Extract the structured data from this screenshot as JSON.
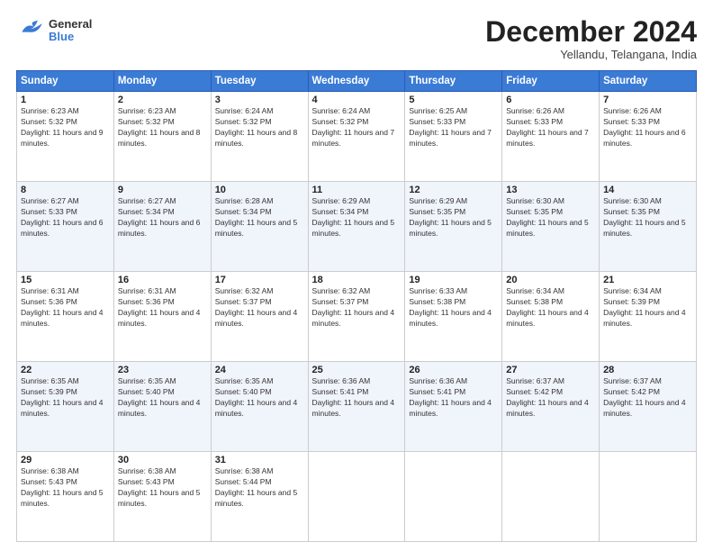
{
  "header": {
    "logo": {
      "general": "General",
      "blue": "Blue"
    },
    "month": "December 2024",
    "location": "Yellandu, Telangana, India"
  },
  "weekdays": [
    "Sunday",
    "Monday",
    "Tuesday",
    "Wednesday",
    "Thursday",
    "Friday",
    "Saturday"
  ],
  "weeks": [
    [
      {
        "day": "1",
        "sunrise": "6:23 AM",
        "sunset": "5:32 PM",
        "daylight": "11 hours and 9 minutes"
      },
      {
        "day": "2",
        "sunrise": "6:23 AM",
        "sunset": "5:32 PM",
        "daylight": "11 hours and 8 minutes"
      },
      {
        "day": "3",
        "sunrise": "6:24 AM",
        "sunset": "5:32 PM",
        "daylight": "11 hours and 8 minutes"
      },
      {
        "day": "4",
        "sunrise": "6:24 AM",
        "sunset": "5:32 PM",
        "daylight": "11 hours and 7 minutes"
      },
      {
        "day": "5",
        "sunrise": "6:25 AM",
        "sunset": "5:33 PM",
        "daylight": "11 hours and 7 minutes"
      },
      {
        "day": "6",
        "sunrise": "6:26 AM",
        "sunset": "5:33 PM",
        "daylight": "11 hours and 7 minutes"
      },
      {
        "day": "7",
        "sunrise": "6:26 AM",
        "sunset": "5:33 PM",
        "daylight": "11 hours and 6 minutes"
      }
    ],
    [
      {
        "day": "8",
        "sunrise": "6:27 AM",
        "sunset": "5:33 PM",
        "daylight": "11 hours and 6 minutes"
      },
      {
        "day": "9",
        "sunrise": "6:27 AM",
        "sunset": "5:34 PM",
        "daylight": "11 hours and 6 minutes"
      },
      {
        "day": "10",
        "sunrise": "6:28 AM",
        "sunset": "5:34 PM",
        "daylight": "11 hours and 5 minutes"
      },
      {
        "day": "11",
        "sunrise": "6:29 AM",
        "sunset": "5:34 PM",
        "daylight": "11 hours and 5 minutes"
      },
      {
        "day": "12",
        "sunrise": "6:29 AM",
        "sunset": "5:35 PM",
        "daylight": "11 hours and 5 minutes"
      },
      {
        "day": "13",
        "sunrise": "6:30 AM",
        "sunset": "5:35 PM",
        "daylight": "11 hours and 5 minutes"
      },
      {
        "day": "14",
        "sunrise": "6:30 AM",
        "sunset": "5:35 PM",
        "daylight": "11 hours and 5 minutes"
      }
    ],
    [
      {
        "day": "15",
        "sunrise": "6:31 AM",
        "sunset": "5:36 PM",
        "daylight": "11 hours and 4 minutes"
      },
      {
        "day": "16",
        "sunrise": "6:31 AM",
        "sunset": "5:36 PM",
        "daylight": "11 hours and 4 minutes"
      },
      {
        "day": "17",
        "sunrise": "6:32 AM",
        "sunset": "5:37 PM",
        "daylight": "11 hours and 4 minutes"
      },
      {
        "day": "18",
        "sunrise": "6:32 AM",
        "sunset": "5:37 PM",
        "daylight": "11 hours and 4 minutes"
      },
      {
        "day": "19",
        "sunrise": "6:33 AM",
        "sunset": "5:38 PM",
        "daylight": "11 hours and 4 minutes"
      },
      {
        "day": "20",
        "sunrise": "6:34 AM",
        "sunset": "5:38 PM",
        "daylight": "11 hours and 4 minutes"
      },
      {
        "day": "21",
        "sunrise": "6:34 AM",
        "sunset": "5:39 PM",
        "daylight": "11 hours and 4 minutes"
      }
    ],
    [
      {
        "day": "22",
        "sunrise": "6:35 AM",
        "sunset": "5:39 PM",
        "daylight": "11 hours and 4 minutes"
      },
      {
        "day": "23",
        "sunrise": "6:35 AM",
        "sunset": "5:40 PM",
        "daylight": "11 hours and 4 minutes"
      },
      {
        "day": "24",
        "sunrise": "6:35 AM",
        "sunset": "5:40 PM",
        "daylight": "11 hours and 4 minutes"
      },
      {
        "day": "25",
        "sunrise": "6:36 AM",
        "sunset": "5:41 PM",
        "daylight": "11 hours and 4 minutes"
      },
      {
        "day": "26",
        "sunrise": "6:36 AM",
        "sunset": "5:41 PM",
        "daylight": "11 hours and 4 minutes"
      },
      {
        "day": "27",
        "sunrise": "6:37 AM",
        "sunset": "5:42 PM",
        "daylight": "11 hours and 4 minutes"
      },
      {
        "day": "28",
        "sunrise": "6:37 AM",
        "sunset": "5:42 PM",
        "daylight": "11 hours and 4 minutes"
      }
    ],
    [
      {
        "day": "29",
        "sunrise": "6:38 AM",
        "sunset": "5:43 PM",
        "daylight": "11 hours and 5 minutes"
      },
      {
        "day": "30",
        "sunrise": "6:38 AM",
        "sunset": "5:43 PM",
        "daylight": "11 hours and 5 minutes"
      },
      {
        "day": "31",
        "sunrise": "6:38 AM",
        "sunset": "5:44 PM",
        "daylight": "11 hours and 5 minutes"
      },
      null,
      null,
      null,
      null
    ]
  ]
}
